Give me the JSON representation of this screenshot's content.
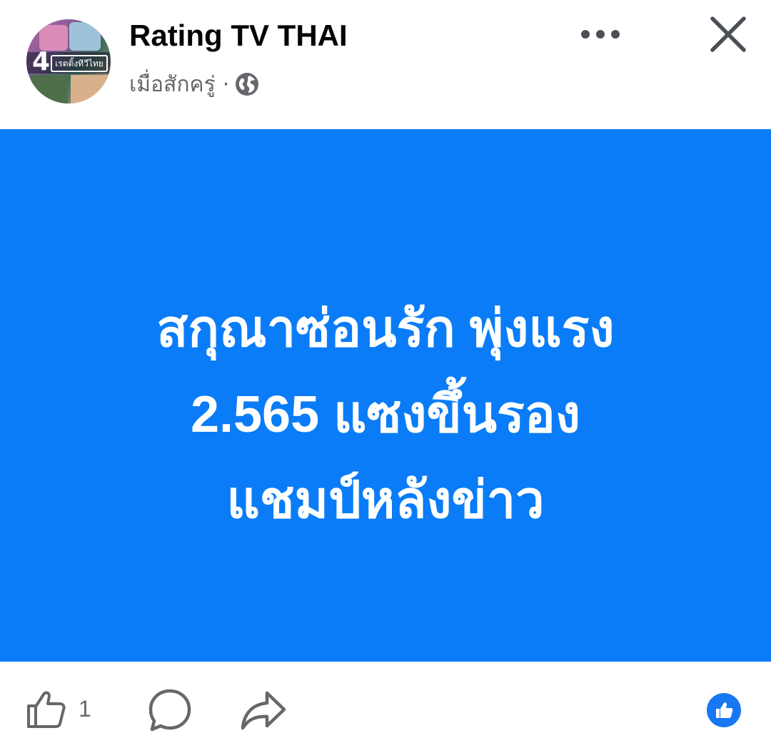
{
  "post": {
    "page_name": "Rating TV THAI",
    "timestamp": "เมื่อสักครู่",
    "separator": "·",
    "audience_icon": "globe-icon",
    "avatar": {
      "number": "4",
      "tag": "เรตติ้งทีวีไทย"
    },
    "header_actions": {
      "more_icon": "more-horizontal-icon",
      "close_icon": "close-icon"
    },
    "card": {
      "background": "#0a7cf7",
      "text_color": "#ffffff",
      "lines": [
        "สกุณาซ่อนรัก พุ่งแรง",
        "2.565 แซงขึ้นรอง",
        "แชมป์หลังข่าว"
      ]
    },
    "actions": {
      "like_icon": "thumbs-up-icon",
      "like_count": "1",
      "comment_icon": "comment-icon",
      "share_icon": "share-icon",
      "reaction_icon": "like-reaction-icon",
      "accent": "#1877f2"
    }
  }
}
